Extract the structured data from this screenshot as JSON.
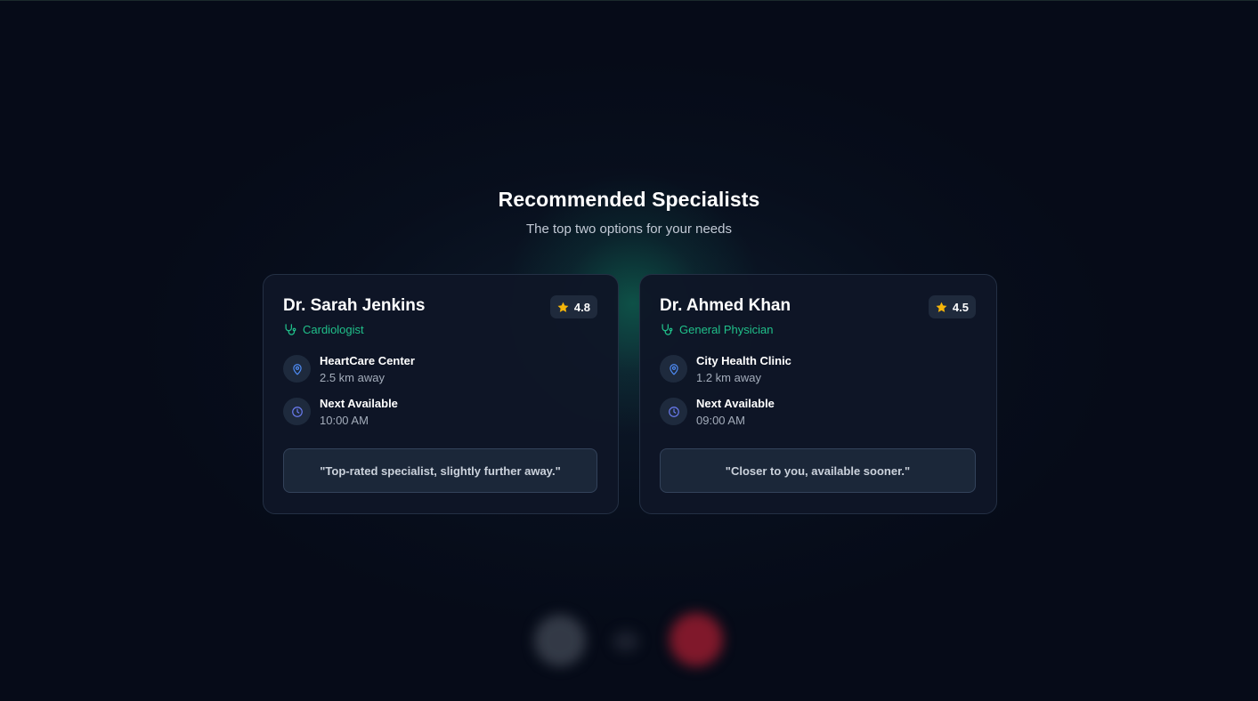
{
  "header": {
    "title": "Recommended Specialists",
    "subtitle": "The top two options for your needs"
  },
  "specialists": [
    {
      "name": "Dr. Sarah Jenkins",
      "rating": "4.8",
      "specialty": "Cardiologist",
      "clinic": "HeartCare Center",
      "distance": "2.5 km away",
      "availability_label": "Next Available",
      "availability_time": "10:00 AM",
      "note": "\"Top-rated specialist, slightly further away.\""
    },
    {
      "name": "Dr. Ahmed Khan",
      "rating": "4.5",
      "specialty": "General Physician",
      "clinic": "City Health Clinic",
      "distance": "1.2 km away",
      "availability_label": "Next Available",
      "availability_time": "09:00 AM",
      "note": "\"Closer to you, available sooner.\""
    }
  ],
  "icons": {
    "rating": "star-icon",
    "specialty": "stethoscope-icon",
    "location": "map-pin-icon",
    "availability": "clock-icon"
  },
  "colors": {
    "background": "#060b18",
    "card": "#0f1626",
    "accent_green": "#20c08a",
    "star": "#f5b50a",
    "icon_blue": "#4f8df7",
    "end_call": "#aa1e32"
  }
}
